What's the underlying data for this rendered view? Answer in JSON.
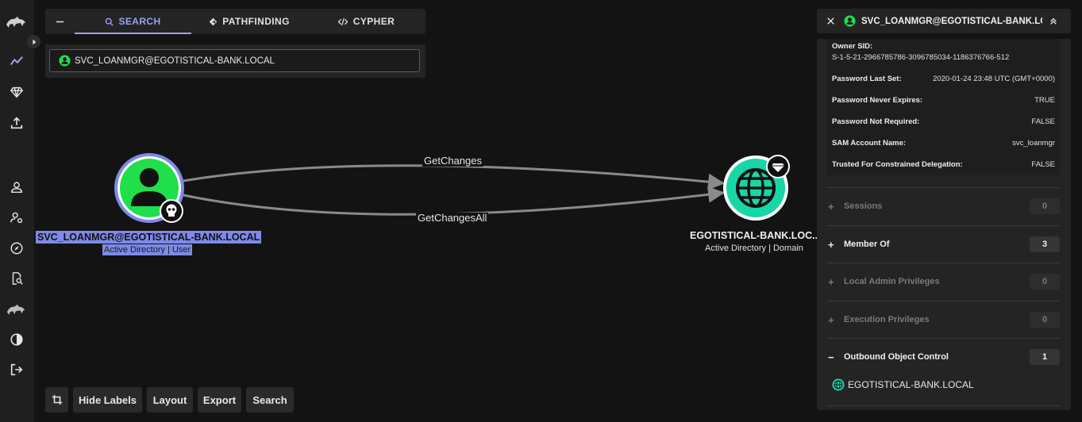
{
  "colors": {
    "accent": "#9aa4ef",
    "user_node": "#1fe04a",
    "domain_node": "#19d6a6",
    "selection": "#7f89e8"
  },
  "rail": {
    "icons": [
      "bloodhound-logo-icon",
      "trend-icon",
      "diamond-icon",
      "upload-icon",
      "user-icon",
      "user-gear-icon",
      "compass-icon",
      "search-doc-icon",
      "bloodhound-icon",
      "contrast-icon",
      "logout-icon"
    ]
  },
  "tabs": {
    "search": "SEARCH",
    "pathfinding": "PATHFINDING",
    "cypher": "CYPHER"
  },
  "search": {
    "value": "SVC_LOANMGR@EGOTISTICAL-BANK.LOCAL"
  },
  "graph": {
    "edges": [
      {
        "label": "GetChanges"
      },
      {
        "label": "GetChangesAll"
      }
    ],
    "source": {
      "name": "SVC_LOANMGR@EGOTISTICAL-BANK.LOCAL",
      "kind": "Active Directory | User"
    },
    "target": {
      "name": "EGOTISTICAL-BANK.LOC...",
      "kind": "Active Directory | Domain"
    }
  },
  "toolbar": {
    "hide_labels": "Hide Labels",
    "layout": "Layout",
    "export": "Export",
    "search": "Search"
  },
  "panel": {
    "title": "SVC_LOANMGR@EGOTISTICAL-BANK.LOC...",
    "owner_sid_label": "Owner SID:",
    "owner_sid_value": "S-1-5-21-2966785786-3096785034-1186376766-512",
    "props": [
      {
        "k": "Password Last Set:",
        "v": "2020-01-24 23:48 UTC (GMT+0000)"
      },
      {
        "k": "Password Never Expires:",
        "v": "TRUE"
      },
      {
        "k": "Password Not Required:",
        "v": "FALSE"
      },
      {
        "k": "SAM Account Name:",
        "v": "svc_loanmgr"
      },
      {
        "k": "Trusted For Constrained Delegation:",
        "v": "FALSE"
      }
    ],
    "sections": [
      {
        "label": "Sessions",
        "count": "0"
      },
      {
        "label": "Member Of",
        "count": "3"
      },
      {
        "label": "Local Admin Privileges",
        "count": "0"
      },
      {
        "label": "Execution Privileges",
        "count": "0"
      },
      {
        "label": "Outbound Object Control",
        "count": "1"
      }
    ],
    "outbound_item": "EGOTISTICAL-BANK.LOCAL"
  }
}
